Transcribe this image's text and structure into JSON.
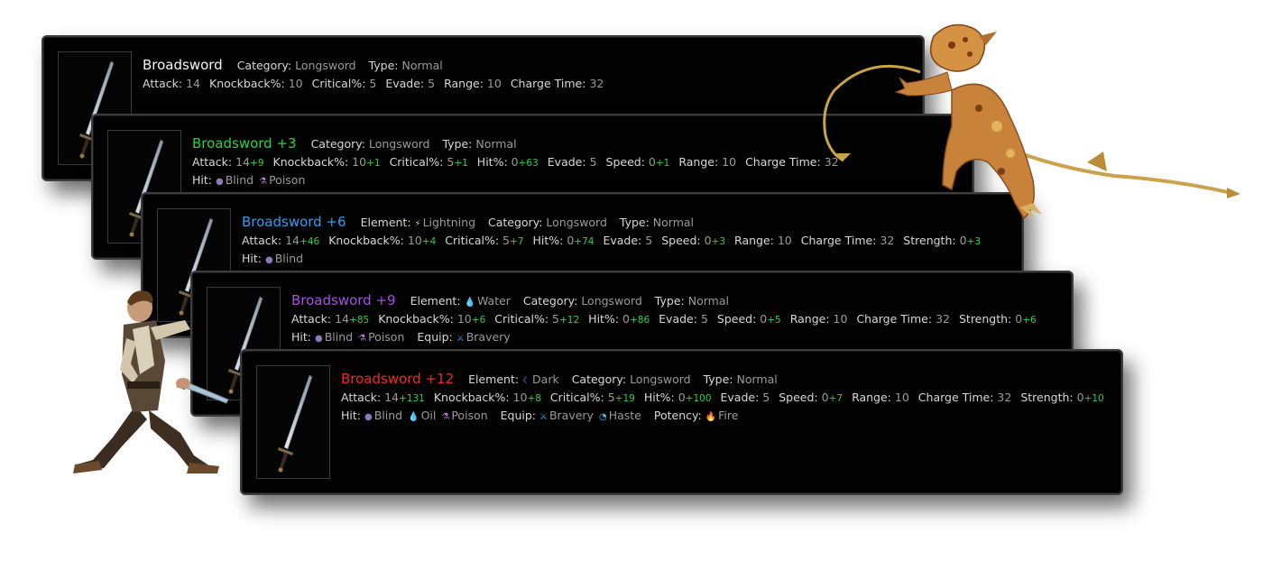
{
  "colors": {
    "white": "#f4f4f4",
    "green": "#2ed04a",
    "blue": "#2b9ff0",
    "purple": "#a64ee8",
    "red": "#f02a2a",
    "bonus": "#2ed04a"
  },
  "cards": [
    {
      "name": "Broadsword",
      "category_label": "Category:",
      "category": "Longsword",
      "type_label": "Type:",
      "type": "Normal",
      "stats": [
        {
          "label": "Attack:",
          "base": "14"
        },
        {
          "label": "Knockback%:",
          "base": "10"
        },
        {
          "label": "Critical%:",
          "base": "5"
        },
        {
          "label": "Evade:",
          "base": "5"
        },
        {
          "label": "Range:",
          "base": "10"
        },
        {
          "label": "Charge Time:",
          "base": "32"
        }
      ]
    },
    {
      "name": "Broadsword +3",
      "category_label": "Category:",
      "category": "Longsword",
      "type_label": "Type:",
      "type": "Normal",
      "stats": [
        {
          "label": "Attack:",
          "base": "14",
          "bonus": "+9"
        },
        {
          "label": "Knockback%:",
          "base": "10",
          "bonus": "+1"
        },
        {
          "label": "Critical%:",
          "base": "5",
          "bonus": "+1"
        },
        {
          "label": "Hit%:",
          "base": "0",
          "bonus": "+63"
        },
        {
          "label": "Evade:",
          "base": "5"
        },
        {
          "label": "Speed:",
          "base": "0",
          "bonus": "+1"
        },
        {
          "label": "Range:",
          "base": "10"
        },
        {
          "label": "Charge Time:",
          "base": "32"
        }
      ],
      "hit_label": "Hit:",
      "hit": [
        "Blind",
        "Poison"
      ]
    },
    {
      "name": "Broadsword +6",
      "element_label": "Element:",
      "element": "Lightning",
      "category_label": "Category:",
      "category": "Longsword",
      "type_label": "Type:",
      "type": "Normal",
      "stats": [
        {
          "label": "Attack:",
          "base": "14",
          "bonus": "+46"
        },
        {
          "label": "Knockback%:",
          "base": "10",
          "bonus": "+4"
        },
        {
          "label": "Critical%:",
          "base": "5",
          "bonus": "+7"
        },
        {
          "label": "Hit%:",
          "base": "0",
          "bonus": "+74"
        },
        {
          "label": "Evade:",
          "base": "5"
        },
        {
          "label": "Speed:",
          "base": "0",
          "bonus": "+3"
        },
        {
          "label": "Range:",
          "base": "10"
        },
        {
          "label": "Charge Time:",
          "base": "32"
        },
        {
          "label": "Strength:",
          "base": "0",
          "bonus": "+3"
        }
      ],
      "hit_label": "Hit:",
      "hit": [
        "Blind"
      ]
    },
    {
      "name": "Broadsword +9",
      "element_label": "Element:",
      "element": "Water",
      "category_label": "Category:",
      "category": "Longsword",
      "type_label": "Type:",
      "type": "Normal",
      "stats": [
        {
          "label": "Attack:",
          "base": "14",
          "bonus": "+85"
        },
        {
          "label": "Knockback%:",
          "base": "10",
          "bonus": "+6"
        },
        {
          "label": "Critical%:",
          "base": "5",
          "bonus": "+12"
        },
        {
          "label": "Hit%:",
          "base": "0",
          "bonus": "+86"
        },
        {
          "label": "Evade:",
          "base": "5"
        },
        {
          "label": "Speed:",
          "base": "0",
          "bonus": "+5"
        },
        {
          "label": "Range:",
          "base": "10"
        },
        {
          "label": "Charge Time:",
          "base": "32"
        },
        {
          "label": "Strength:",
          "base": "0",
          "bonus": "+6"
        }
      ],
      "hit_label": "Hit:",
      "hit": [
        "Blind",
        "Poison"
      ],
      "equip_label": "Equip:",
      "equip": [
        "Bravery"
      ]
    },
    {
      "name": "Broadsword +12",
      "element_label": "Element:",
      "element": "Dark",
      "category_label": "Category:",
      "category": "Longsword",
      "type_label": "Type:",
      "type": "Normal",
      "stats": [
        {
          "label": "Attack:",
          "base": "14",
          "bonus": "+131"
        },
        {
          "label": "Knockback%:",
          "base": "10",
          "bonus": "+8"
        },
        {
          "label": "Critical%:",
          "base": "5",
          "bonus": "+19"
        },
        {
          "label": "Hit%:",
          "base": "0",
          "bonus": "+100"
        },
        {
          "label": "Evade:",
          "base": "5"
        },
        {
          "label": "Speed:",
          "base": "0",
          "bonus": "+7"
        },
        {
          "label": "Range:",
          "base": "10"
        },
        {
          "label": "Charge Time:",
          "base": "32"
        },
        {
          "label": "Strength:",
          "base": "0",
          "bonus": "+10"
        }
      ],
      "hit_label": "Hit:",
      "hit": [
        "Blind",
        "Oil",
        "Poison"
      ],
      "equip_label": "Equip:",
      "equip": [
        "Bravery",
        "Haste"
      ],
      "potency_label": "Potency:",
      "potency": [
        "Fire"
      ]
    }
  ],
  "icons": {
    "Lightning": "lightning-icon",
    "Water": "water-drop-icon",
    "Dark": "dark-crescent-icon",
    "Blind": "blind-orb-icon",
    "Oil": "oil-drop-icon",
    "Poison": "poison-flask-icon",
    "Bravery": "bravery-icon",
    "Haste": "haste-icon",
    "Fire": "fire-icon"
  }
}
